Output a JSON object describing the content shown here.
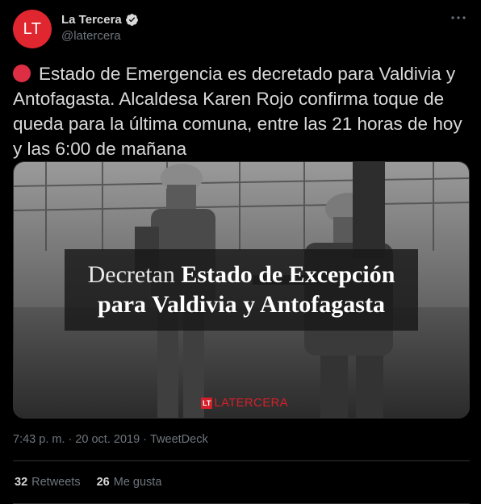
{
  "author": {
    "avatar_text": "LT",
    "name": "La Tercera",
    "handle": "@latercera",
    "verified_icon": "verified-badge-icon"
  },
  "tweet": {
    "emoji": "red-circle-icon",
    "text": "Estado de Emergencia es decretado para Valdivia y Antofagasta. Alcaldesa Karen Rojo confirma toque de queda para la última comuna, entre las 21 horas de hoy y las 6:00 de mañana"
  },
  "media": {
    "headline_light": "Decretan",
    "headline_bold": "Estado de Excepción",
    "headline_line2": "para Valdivia y Antofagasta",
    "logo_badge": "LT",
    "logo_text": "LATERCERA"
  },
  "meta": {
    "time": "7:43 p. m.",
    "separator1": "·",
    "date": "20 oct. 2019",
    "separator2": "·",
    "source": "TweetDeck"
  },
  "stats": {
    "retweets_count": "32",
    "retweets_label": "Retweets",
    "likes_count": "26",
    "likes_label": "Me gusta"
  },
  "colors": {
    "background": "#000000",
    "avatar_bg": "#e0262f",
    "text_primary": "#d9d9d9",
    "text_secondary": "#6e767d",
    "verified": "#d9d9d9",
    "brand_red": "#d4202a"
  }
}
